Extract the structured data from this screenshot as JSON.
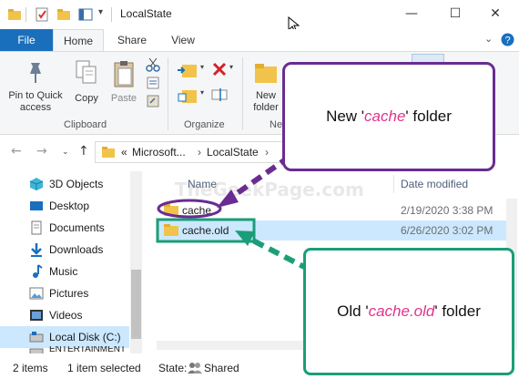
{
  "window": {
    "title": "LocalState",
    "minimize": "—",
    "maximize": "☐",
    "close": "✕"
  },
  "ribbon_tabs": [
    {
      "label": "File"
    },
    {
      "label": "Home"
    },
    {
      "label": "Share"
    },
    {
      "label": "View"
    }
  ],
  "ribbon": {
    "pin_label": "Pin to Quick access",
    "copy_label": "Copy",
    "paste_label": "Paste",
    "new_folder_label": "New folder",
    "new_group_partial": "Ne",
    "clipboard_group": "Clipboard",
    "organize_group": "Organize"
  },
  "address": {
    "prefix": "«",
    "crumb1": "Microsoft...",
    "sep": "›",
    "crumb2": "LocalState",
    "sep2": "›"
  },
  "navpane": {
    "items": [
      {
        "label": "3D Objects",
        "icon": "3d-objects-icon"
      },
      {
        "label": "Desktop",
        "icon": "desktop-icon"
      },
      {
        "label": "Documents",
        "icon": "documents-icon"
      },
      {
        "label": "Downloads",
        "icon": "downloads-icon"
      },
      {
        "label": "Music",
        "icon": "music-icon"
      },
      {
        "label": "Pictures",
        "icon": "pictures-icon"
      },
      {
        "label": "Videos",
        "icon": "videos-icon"
      },
      {
        "label": "Local Disk (C:)",
        "icon": "local-disk-icon"
      },
      {
        "label": "ENTERTAINMENT",
        "icon": "drive-icon"
      }
    ]
  },
  "filelist": {
    "col_name": "Name",
    "col_date": "Date modified",
    "rows": [
      {
        "name": "cache",
        "date": "2/19/2020 3:38 PM"
      },
      {
        "name": "cache.old",
        "date": "6/26/2020 3:02 PM"
      }
    ]
  },
  "statusbar": {
    "items_count": "2 items",
    "selected": "1 item selected",
    "state_label": "State:",
    "state_value": "Shared"
  },
  "callouts": {
    "new_prefix": "New '",
    "new_em": "cache",
    "new_suffix": "' folder",
    "old_prefix": "Old '",
    "old_em": "cache.old",
    "old_suffix": "' folder"
  },
  "watermark": "TheGeekPage.com",
  "colors": {
    "file_tab": "#1a6fbd",
    "selection": "#cce8ff",
    "callout_new_border": "#6a2c91",
    "callout_old_border": "#1b9e77",
    "highlight_text": "#e0338c"
  }
}
